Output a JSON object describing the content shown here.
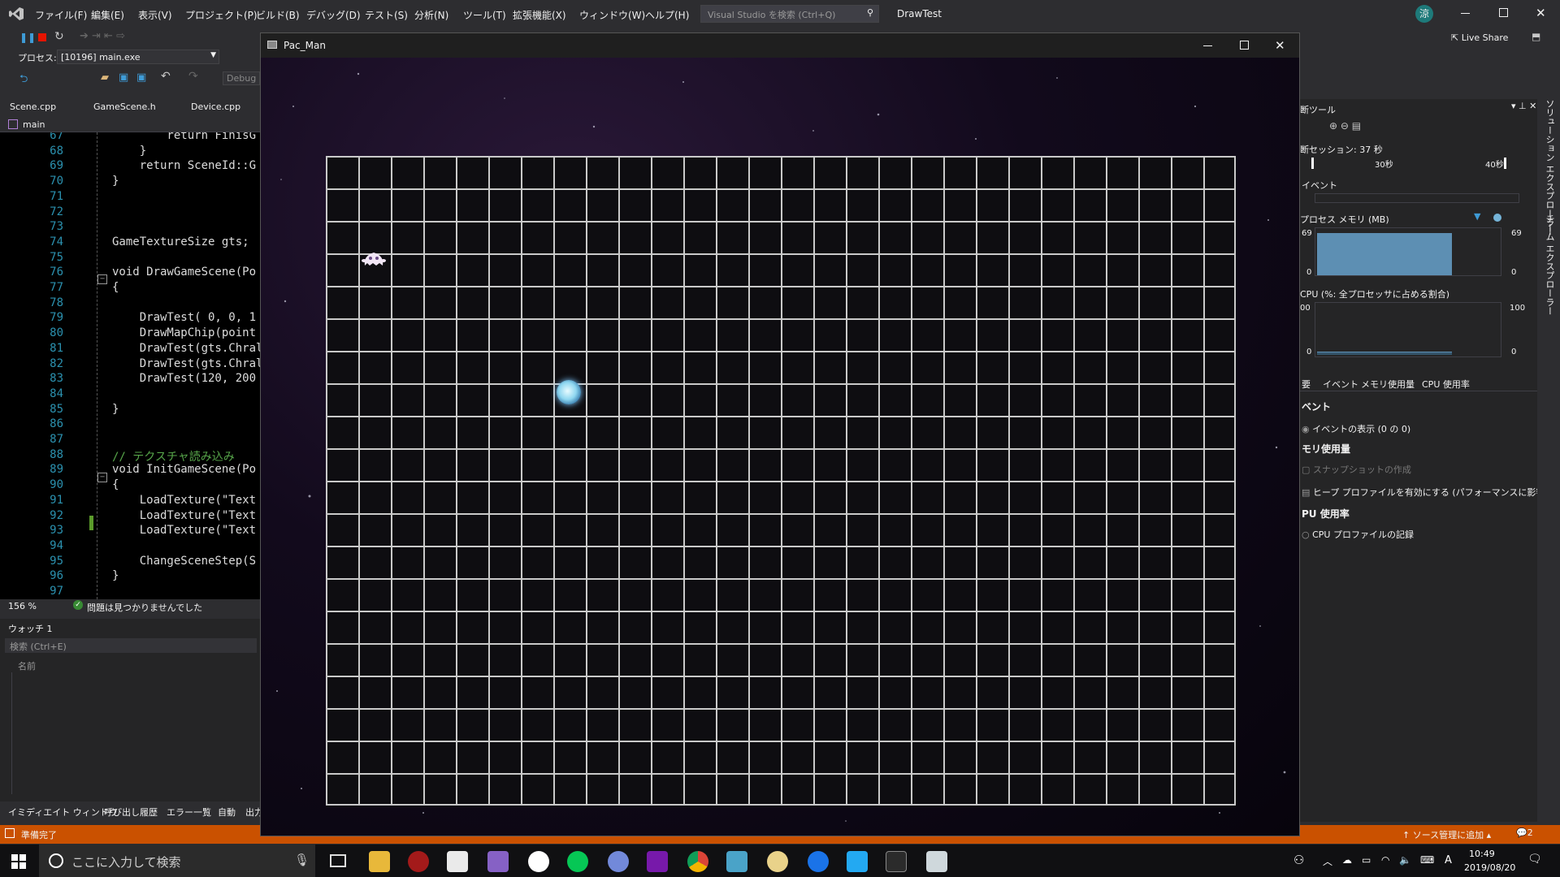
{
  "vs": {
    "menu": [
      "ファイル(F)",
      "編集(E)",
      "表示(V)",
      "プロジェクト(P)",
      "ビルド(B)",
      "デバッグ(D)",
      "テスト(S)",
      "分析(N)",
      "ツール(T)",
      "拡張機能(X)",
      "ウィンドウ(W)",
      "ヘルプ(H)"
    ],
    "search_placeholder": "Visual Studio を検索 (Ctrl+Q)",
    "solution_name": "DrawTest",
    "user_initial": "涼",
    "live_share": "Live Share",
    "process_label": "プロセス:",
    "process_value": "[10196] main.exe",
    "config": "Debug",
    "file_tabs": [
      "Scene.cpp",
      "GameScene.h",
      "Device.cpp"
    ],
    "nav_scope": "main",
    "zoom": "156 %",
    "issues": "問題は見つかりませんでした",
    "status": "準備完了",
    "source_control": "ソース管理に追加",
    "notif_count": "2"
  },
  "code_lines": [
    {
      "n": "67",
      "t": "        return FinisG"
    },
    {
      "n": "68",
      "t": "    }"
    },
    {
      "n": "69",
      "t": "    return SceneId::G"
    },
    {
      "n": "70",
      "t": "}"
    },
    {
      "n": "71",
      "t": ""
    },
    {
      "n": "72",
      "t": ""
    },
    {
      "n": "73",
      "t": ""
    },
    {
      "n": "74",
      "t": "GameTextureSize gts;"
    },
    {
      "n": "75",
      "t": ""
    },
    {
      "n": "76",
      "t": "void DrawGameScene(Po"
    },
    {
      "n": "77",
      "t": "{"
    },
    {
      "n": "78",
      "t": ""
    },
    {
      "n": "79",
      "t": "    DrawTest( 0, 0, 1"
    },
    {
      "n": "80",
      "t": "    DrawMapChip(point"
    },
    {
      "n": "81",
      "t": "    DrawTest(gts.Chral"
    },
    {
      "n": "82",
      "t": "    DrawTest(gts.Chral"
    },
    {
      "n": "83",
      "t": "    DrawTest(120, 200"
    },
    {
      "n": "84",
      "t": ""
    },
    {
      "n": "85",
      "t": "}"
    },
    {
      "n": "86",
      "t": ""
    },
    {
      "n": "87",
      "t": ""
    },
    {
      "n": "88",
      "t": "// テクスチャ読み込み"
    },
    {
      "n": "89",
      "t": "void InitGameScene(Po"
    },
    {
      "n": "90",
      "t": "{"
    },
    {
      "n": "91",
      "t": "    LoadTexture(\"Text"
    },
    {
      "n": "92",
      "t": "    LoadTexture(\"Text"
    },
    {
      "n": "93",
      "t": "    LoadTexture(\"Text"
    },
    {
      "n": "94",
      "t": ""
    },
    {
      "n": "95",
      "t": "    ChangeSceneStep(S"
    },
    {
      "n": "96",
      "t": "}"
    },
    {
      "n": "97",
      "t": ""
    }
  ],
  "watch": {
    "title": "ウォッチ 1",
    "search": "検索 (Ctrl+E)",
    "col_name": "名前"
  },
  "bottom_tabs": [
    "イミディエイト ウィンドウ",
    "呼び出し履歴",
    "エラー一覧",
    "自動",
    "出力"
  ],
  "diag": {
    "title": "断ツール",
    "session": "断セッション: 37 秒",
    "ticks": [
      "30秒",
      "40秒"
    ],
    "events": "イベント",
    "mem_title": "プロセス メモリ (MB)",
    "mem_max": "69",
    "mem_min": "0",
    "cpu_title": "CPU (%: 全プロセッサに占める割合)",
    "cpu_max": "100",
    "cpu_max_left": "00",
    "cpu_min": "0",
    "tabs": [
      "要",
      "イベント",
      "メモリ使用量",
      "CPU 使用率"
    ],
    "sec_events": "ベント",
    "show_events": "イベントの表示 (0 の 0)",
    "sec_mem": "モリ使用量",
    "snapshot": "スナップショットの作成",
    "heap": "ヒープ プロファイルを有効にする (パフォーマンスに影響しま",
    "sec_cpu": "PU 使用率",
    "cpu_record": "CPU プロファイルの記録",
    "vertical_1": "ソリューション エクスプローラー",
    "vertical_2": "チーム エクスプローラー"
  },
  "game": {
    "title": "Pac_Man",
    "grid_cols": 28,
    "grid_rows": 20
  },
  "taskbar": {
    "search_placeholder": "ここに入力して検索",
    "time": "10:49",
    "date": "2019/08/20",
    "ime": "A"
  }
}
